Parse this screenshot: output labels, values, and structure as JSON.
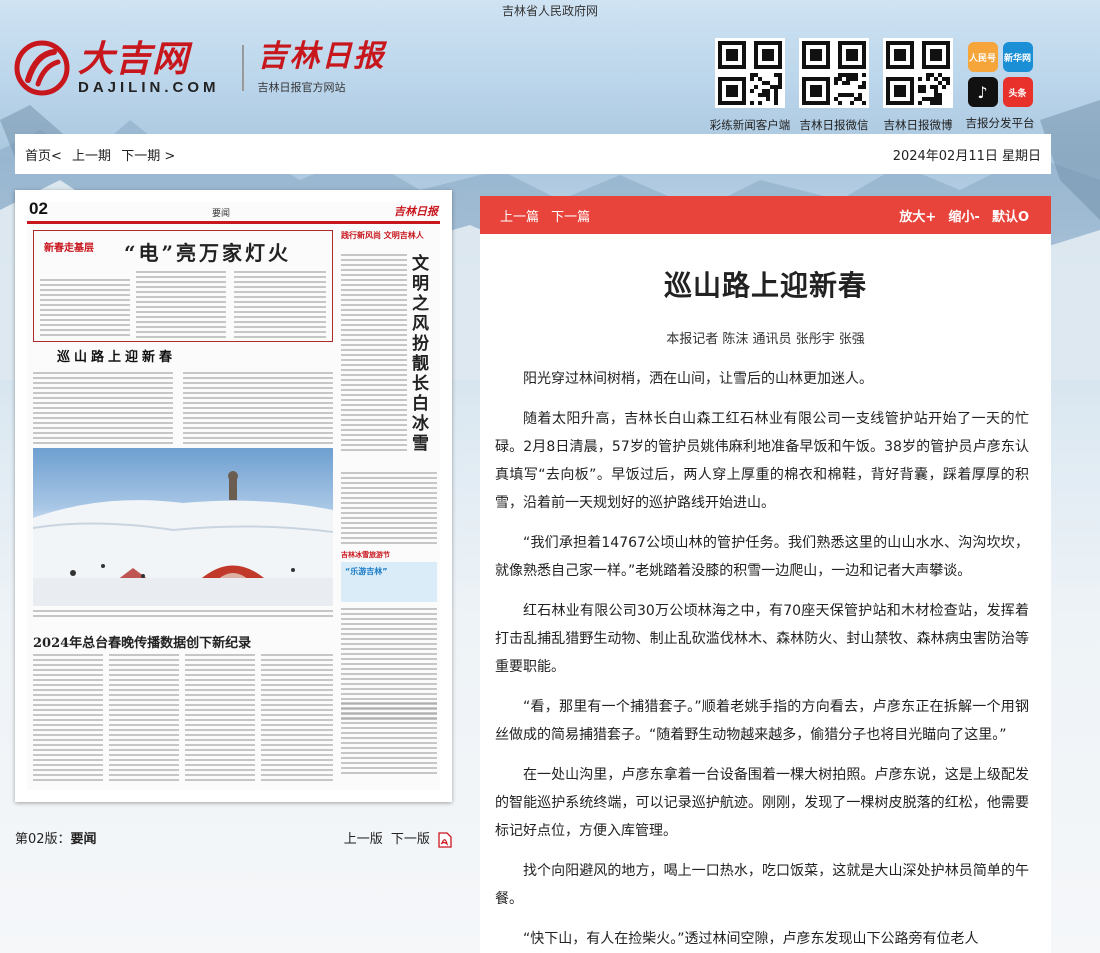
{
  "top_bar": {
    "gov_title": "吉林省人民政府网"
  },
  "header": {
    "site_logo_text": "大吉网",
    "site_logo_domain": "DAJILIN.COM",
    "paper_logo_text": "吉林日报",
    "paper_logo_sub": "吉林日报官方网站",
    "qr_codes": [
      {
        "caption": "彩练新闻客户端"
      },
      {
        "caption": "吉林日报微信"
      },
      {
        "caption": "吉林日报微博"
      }
    ],
    "platforms": {
      "caption": "吉报分发平台",
      "icons": [
        {
          "name": "renmin-icon",
          "label": "人民号",
          "color": "#f2a23c"
        },
        {
          "name": "xinhua-icon",
          "label": "新华网",
          "color": "#1a8fd6"
        },
        {
          "name": "douyin-icon",
          "label": "♪",
          "color": "#111111"
        },
        {
          "name": "toutiao-icon",
          "label": "头条",
          "color": "#e8312b"
        }
      ]
    }
  },
  "nav": {
    "home": "首页<",
    "prev_issue": "上一期",
    "next_issue": "下一期 >",
    "date": "2024年02月11日  星期日"
  },
  "newspaper": {
    "page_number": "02",
    "section": "要闻",
    "paper_logo": "吉林日报",
    "festival_badge": "新春走基层",
    "headline_main": "“电”亮万家灯火",
    "headline_second": "巡山路上迎新春",
    "side_tag": "践行新风尚 文明吉林人",
    "side_headline": "文明之风扮靓长白冰雪",
    "bottom_headline": "2024年总台春晚传播数据创下新纪录",
    "promo_text": "“乐游吉林”",
    "promo_red": "吉林冰雪旅游节"
  },
  "paper_caption": {
    "edition_label": "第02版：",
    "edition_name": "要闻",
    "prev_page": "上一版",
    "next_page": "下一版"
  },
  "article": {
    "toolbar": {
      "prev": "上一篇",
      "next": "下一篇",
      "zoom_in": "放大+",
      "zoom_out": "缩小-",
      "default": "默认O"
    },
    "title": "巡山路上迎新春",
    "byline": "本报记者 陈沫 通讯员 张彤宇 张强",
    "paragraphs": [
      "阳光穿过林间树梢，洒在山间，让雪后的山林更加迷人。",
      "随着太阳升高，吉林长白山森工红石林业有限公司一支线管护站开始了一天的忙碌。2月8日清晨，57岁的管护员姚伟麻利地准备早饭和午饭。38岁的管护员卢彦东认真填写“去向板”。早饭过后，两人穿上厚重的棉衣和棉鞋，背好背囊，踩着厚厚的积雪，沿着前一天规划好的巡护路线开始进山。",
      "“我们承担着14767公顷山林的管护任务。我们熟悉这里的山山水水、沟沟坎坎，就像熟悉自己家一样。”老姚踏着没膝的积雪一边爬山，一边和记者大声攀谈。",
      "红石林业有限公司30万公顷林海之中，有70座天保管护站和木材检查站，发挥着打击乱捕乱猎野生动物、制止乱砍滥伐林木、森林防火、封山禁牧、森林病虫害防治等重要职能。",
      "“看，那里有一个捕猎套子。”顺着老姚手指的方向看去，卢彦东正在拆解一个用钢丝做成的简易捕猎套子。“随着野生动物越来越多，偷猎分子也将目光瞄向了这里。”",
      "在一处山沟里，卢彦东拿着一台设备围着一棵大树拍照。卢彦东说，这是上级配发的智能巡护系统终端，可以记录巡护航迹。刚刚，发现了一棵树皮脱落的红松，他需要标记好点位，方便入库管理。",
      "找个向阳避风的地方，喝上一口热水，吃口饭菜，这就是大山深处护林员简单的午餐。",
      "“快下山，有人在捡柴火。”透过林间空隙，卢彦东发现山下公路旁有位老人"
    ]
  }
}
